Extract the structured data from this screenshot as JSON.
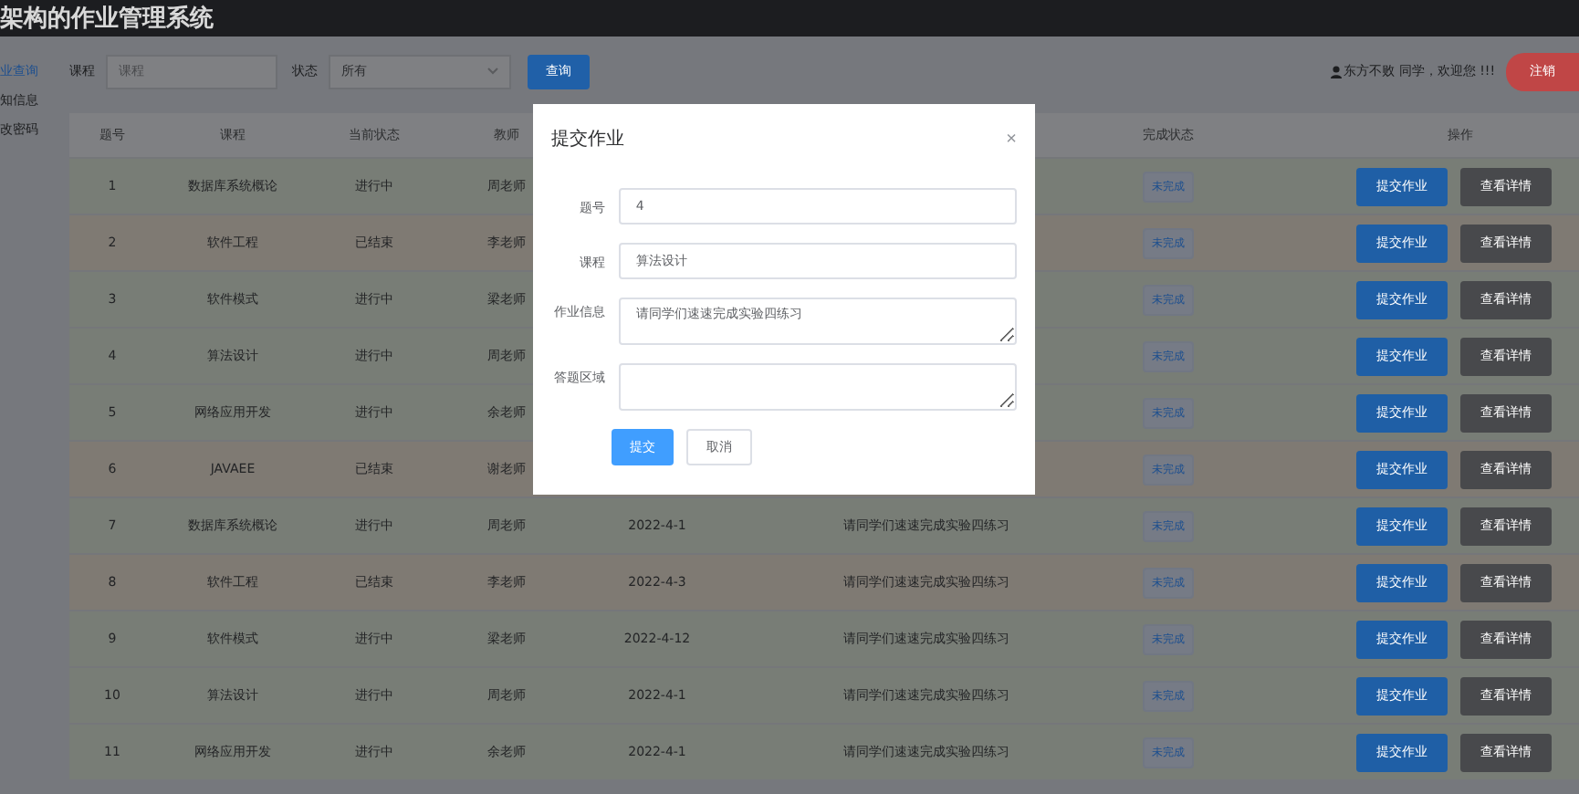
{
  "header": {
    "title": "架构的作业管理系统"
  },
  "sidebar": {
    "items": [
      {
        "label": "业查询",
        "selected": true
      },
      {
        "label": "知信息",
        "selected": false
      },
      {
        "label": "改密码",
        "selected": false
      }
    ]
  },
  "filters": {
    "course_label": "课程",
    "course_placeholder": "课程",
    "status_label": "状态",
    "status_value": "所有",
    "search_button": "查询"
  },
  "user": {
    "greeting": "东方不败  同学，欢迎您 !!!",
    "logout": "注销"
  },
  "table": {
    "columns": [
      "题号",
      "课程",
      "当前状态",
      "教师",
      "完成状态",
      "操作"
    ],
    "rows": [
      {
        "no": "1",
        "course": "数据库系统概论",
        "status": "进行中",
        "teacher": "周老师",
        "done": "未完成",
        "actions": [
          "提交作业",
          "查看详情"
        ],
        "color": "#787d76"
      },
      {
        "no": "2",
        "course": "软件工程",
        "status": "已结束",
        "teacher": "李老师",
        "done": "未完成",
        "actions": [
          "提交作业",
          "查看详情"
        ],
        "color": "#7f7a73"
      },
      {
        "no": "3",
        "course": "软件模式",
        "status": "进行中",
        "teacher": "梁老师",
        "done": "未完成",
        "actions": [
          "提交作业",
          "查看详情"
        ],
        "color": "#787d76"
      },
      {
        "no": "4",
        "course": "算法设计",
        "status": "进行中",
        "teacher": "周老师",
        "done": "未完成",
        "actions": [
          "提交作业",
          "查看详情"
        ],
        "color": "#787d76"
      },
      {
        "no": "5",
        "course": "网络应用开发",
        "status": "进行中",
        "teacher": "余老师",
        "done": "未完成",
        "actions": [
          "提交作业",
          "查看详情"
        ],
        "color": "#787d76"
      },
      {
        "no": "6",
        "course": "JAVAEE",
        "status": "已结束",
        "teacher": "谢老师",
        "done": "未完成",
        "actions": [
          "提交作业",
          "查看详情"
        ],
        "color": "#7f7a73"
      },
      {
        "no": "7",
        "course": "数据库系统概论",
        "status": "进行中",
        "teacher": "周老师",
        "date": "2022-4-1",
        "info": "请同学们速速完成实验四练习",
        "done": "未完成",
        "actions": [
          "提交作业",
          "查看详情"
        ],
        "color": "#787d76"
      },
      {
        "no": "8",
        "course": "软件工程",
        "status": "已结束",
        "teacher": "李老师",
        "date": "2022-4-3",
        "info": "请同学们速速完成实验四练习",
        "done": "未完成",
        "actions": [
          "提交作业",
          "查看详情"
        ],
        "color": "#7f7a73"
      },
      {
        "no": "9",
        "course": "软件模式",
        "status": "进行中",
        "teacher": "梁老师",
        "date": "2022-4-12",
        "info": "请同学们速速完成实验四练习",
        "done": "未完成",
        "actions": [
          "提交作业",
          "查看详情"
        ],
        "color": "#787d76"
      },
      {
        "no": "10",
        "course": "算法设计",
        "status": "进行中",
        "teacher": "周老师",
        "date": "2022-4-1",
        "info": "请同学们速速完成实验四练习",
        "done": "未完成",
        "actions": [
          "提交作业",
          "查看详情"
        ],
        "color": "#787d76"
      },
      {
        "no": "11",
        "course": "网络应用开发",
        "status": "进行中",
        "teacher": "余老师",
        "date": "2022-4-1",
        "info": "请同学们速速完成实验四练习",
        "done": "未完成",
        "actions": [
          "提交作业",
          "查看详情"
        ],
        "color": "#787d76"
      }
    ]
  },
  "dialog": {
    "title": "提交作业",
    "close": "×",
    "fields": [
      {
        "kind": "input",
        "label": "题号",
        "value": "4"
      },
      {
        "kind": "input",
        "label": "课程",
        "value": "算法设计"
      },
      {
        "kind": "textarea",
        "label": "作业信息",
        "value": "请同学们速速完成实验四练习"
      },
      {
        "kind": "textarea",
        "label": "答题区域"
      }
    ],
    "submit": "提交",
    "cancel": "取消"
  }
}
